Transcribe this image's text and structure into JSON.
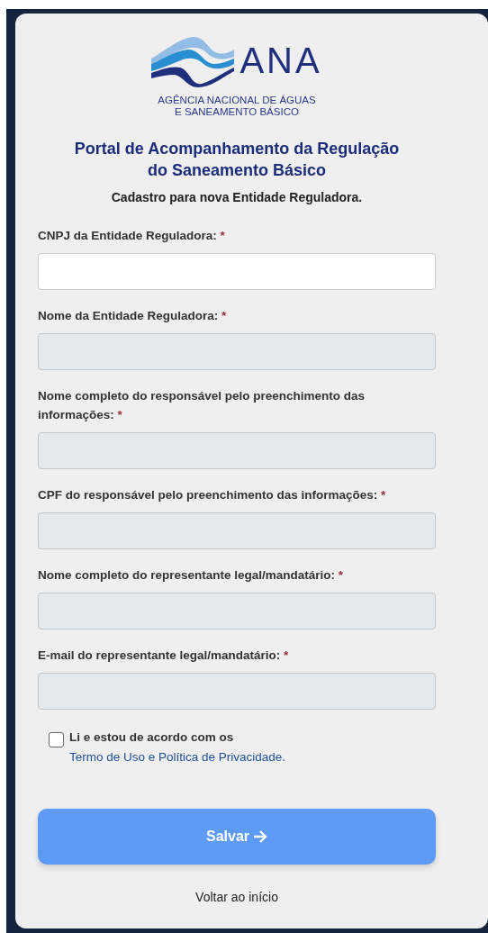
{
  "logo": {
    "wordmark": "ANA",
    "agency_lines": [
      "AGÊNCIA NACIONAL DE ÁGUAS",
      "E SANEAMENTO BÁSICO"
    ]
  },
  "title_lines": [
    "Portal de Acompanhamento da Regulação",
    "do Saneamento Básico"
  ],
  "subtitle": "Cadastro para nova Entidade Reguladora.",
  "required_mark": "*",
  "fields": [
    {
      "label": "CNPJ da Entidade Reguladora:",
      "required": true,
      "disabled": false
    },
    {
      "label": "Nome da Entidade Reguladora:",
      "required": true,
      "disabled": true
    },
    {
      "label": "Nome completo do responsável pelo preenchimento das informações:",
      "required": true,
      "disabled": true
    },
    {
      "label": "CPF do responsável pelo preenchimento das informações:",
      "required": true,
      "disabled": true
    },
    {
      "label": "Nome completo do representante legal/mandatário:",
      "required": true,
      "disabled": true
    },
    {
      "label": "E-mail do representante legal/mandatário:",
      "required": true,
      "disabled": true
    }
  ],
  "agreement": {
    "checked": false,
    "text": "Li e estou de acordo com os",
    "link": "Termo de Uso e Política de Privacidade."
  },
  "save_button": {
    "label": "Salvar",
    "disabled": true
  },
  "back_link": "Voltar ao início"
}
